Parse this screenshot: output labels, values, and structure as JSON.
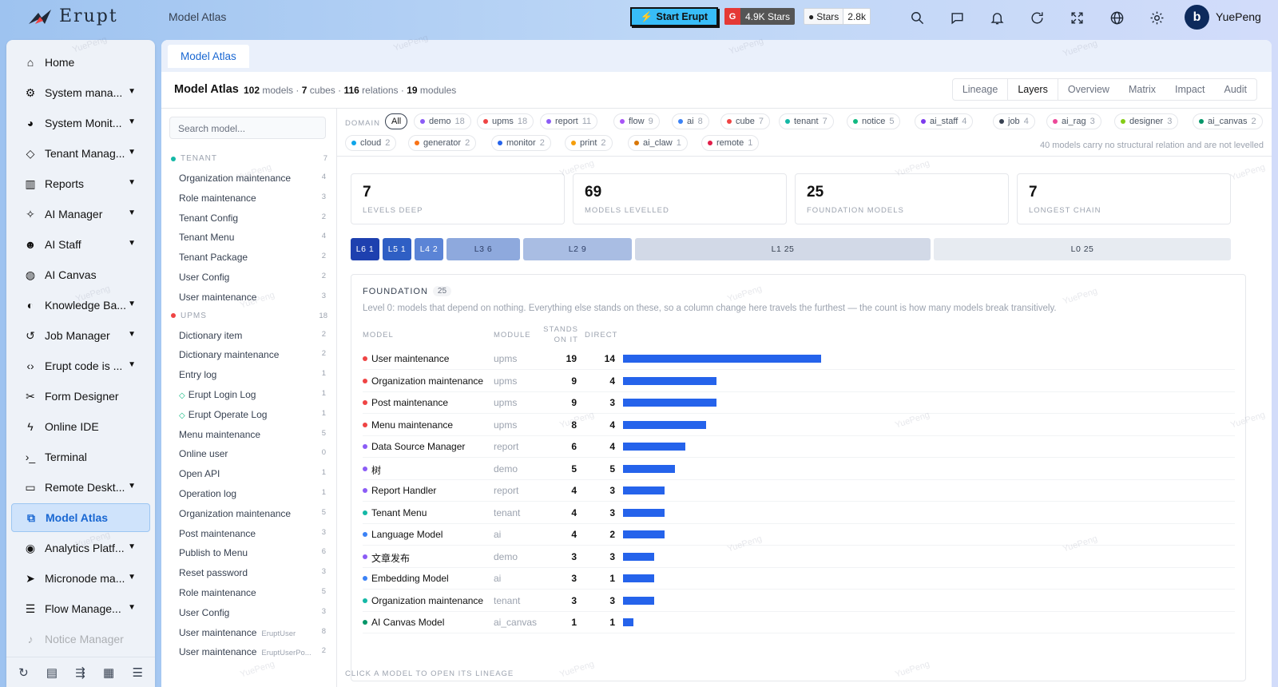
{
  "brand": {
    "name": "Erupt",
    "title": "Model Atlas"
  },
  "header": {
    "start_label": "Start Erupt",
    "gitee_stars": "4.9K Stars",
    "github_label": "Stars",
    "github_count": "2.8k",
    "user": "YuePeng",
    "avatar_initial": "b"
  },
  "sidebar": {
    "items": [
      {
        "label": "Home",
        "icon": "home-icon"
      },
      {
        "label": "System mana...",
        "icon": "gears-icon"
      },
      {
        "label": "System Monit...",
        "icon": "gauge-icon"
      },
      {
        "label": "Tenant Manag...",
        "icon": "gem-icon"
      },
      {
        "label": "Reports",
        "icon": "bar-chart-icon"
      },
      {
        "label": "AI Manager",
        "icon": "magic-icon"
      },
      {
        "label": "AI Staff",
        "icon": "robot-icon"
      },
      {
        "label": "AI Canvas",
        "icon": "palette-icon"
      },
      {
        "label": "Knowledge Ba...",
        "icon": "brain-icon"
      },
      {
        "label": "Job Manager",
        "icon": "history-icon"
      },
      {
        "label": "Erupt code is ...",
        "icon": "code-icon"
      },
      {
        "label": "Form Designer",
        "icon": "tools-icon"
      },
      {
        "label": "Online IDE",
        "icon": "bolt-icon"
      },
      {
        "label": "Terminal",
        "icon": "terminal-icon"
      },
      {
        "label": "Remote Deskt...",
        "icon": "desktop-icon"
      },
      {
        "label": "Model Atlas",
        "icon": "sitemap-icon"
      },
      {
        "label": "Analytics Platf...",
        "icon": "compass-icon"
      },
      {
        "label": "Micronode ma...",
        "icon": "send-icon"
      },
      {
        "label": "Flow Manage...",
        "icon": "sliders-icon"
      },
      {
        "label": "Notice Manager",
        "icon": "bell-icon"
      }
    ]
  },
  "tab": {
    "label": "Model Atlas"
  },
  "summary": {
    "title": "Model Atlas",
    "models": "102",
    "models_label": "models",
    "cubes": "7",
    "cubes_label": "cubes",
    "relations": "116",
    "relations_label": "relations",
    "modules": "19",
    "modules_label": "modules"
  },
  "view_tabs": [
    "Lineage",
    "Layers",
    "Overview",
    "Matrix",
    "Impact",
    "Audit"
  ],
  "search": {
    "placeholder": "Search model..."
  },
  "groups": [
    {
      "name": "TENANT",
      "count": "7",
      "color": "#14b8a6",
      "items": [
        {
          "label": "Organization maintenance",
          "count": "4"
        },
        {
          "label": "Role maintenance",
          "count": "3"
        },
        {
          "label": "Tenant Config",
          "count": "2"
        },
        {
          "label": "Tenant Menu",
          "count": "4"
        },
        {
          "label": "Tenant Package",
          "count": "2"
        },
        {
          "label": "User Config",
          "count": "2"
        },
        {
          "label": "User maintenance",
          "count": "3"
        }
      ]
    },
    {
      "name": "UPMS",
      "count": "18",
      "color": "#ef4444",
      "items": [
        {
          "label": "Dictionary item",
          "count": "2"
        },
        {
          "label": "Dictionary maintenance",
          "count": "2"
        },
        {
          "label": "Entry log",
          "count": "1"
        },
        {
          "label": "Erupt Login Log",
          "count": "1",
          "diamond": true
        },
        {
          "label": "Erupt Operate Log",
          "count": "1",
          "diamond": true
        },
        {
          "label": "Menu maintenance",
          "count": "5"
        },
        {
          "label": "Online user",
          "count": "0"
        },
        {
          "label": "Open API",
          "count": "1"
        },
        {
          "label": "Operation log",
          "count": "1"
        },
        {
          "label": "Organization maintenance",
          "count": "5"
        },
        {
          "label": "Post maintenance",
          "count": "3"
        },
        {
          "label": "Publish to Menu",
          "count": "6"
        },
        {
          "label": "Reset password",
          "count": "3"
        },
        {
          "label": "Role maintenance",
          "count": "5"
        },
        {
          "label": "User Config",
          "count": "3"
        },
        {
          "label": "User maintenance",
          "count": "8",
          "sub": "EruptUser"
        },
        {
          "label": "User maintenance",
          "count": "2",
          "sub": "EruptUserPo..."
        }
      ]
    }
  ],
  "domain": {
    "label": "DOMAIN",
    "all": "All",
    "chips": [
      {
        "name": "demo",
        "count": "18",
        "color": "#8b5cf6"
      },
      {
        "name": "upms",
        "count": "18",
        "color": "#ef4444"
      },
      {
        "name": "report",
        "count": "11",
        "color": "#8b5cf6"
      },
      {
        "name": "flow",
        "count": "9",
        "color": "#a855f7"
      },
      {
        "name": "ai",
        "count": "8",
        "color": "#3b82f6"
      },
      {
        "name": "cube",
        "count": "7",
        "color": "#ef4444"
      },
      {
        "name": "tenant",
        "count": "7",
        "color": "#14b8a6"
      },
      {
        "name": "notice",
        "count": "5",
        "color": "#10b981"
      },
      {
        "name": "ai_staff",
        "count": "4",
        "color": "#7c3aed"
      },
      {
        "name": "job",
        "count": "4",
        "color": "#374151"
      },
      {
        "name": "ai_rag",
        "count": "3",
        "color": "#ec4899"
      },
      {
        "name": "designer",
        "count": "3",
        "color": "#84cc16"
      },
      {
        "name": "ai_canvas",
        "count": "2",
        "color": "#059669"
      },
      {
        "name": "cloud",
        "count": "2",
        "color": "#0ea5e9"
      },
      {
        "name": "generator",
        "count": "2",
        "color": "#f97316"
      },
      {
        "name": "monitor",
        "count": "2",
        "color": "#2563eb"
      },
      {
        "name": "print",
        "count": "2",
        "color": "#f59e0b"
      },
      {
        "name": "ai_claw",
        "count": "1",
        "color": "#d97706"
      },
      {
        "name": "remote",
        "count": "1",
        "color": "#e11d48"
      }
    ],
    "note": "40 models carry no structural relation and are not levelled"
  },
  "stats": [
    {
      "value": "7",
      "label": "LEVELS DEEP"
    },
    {
      "value": "69",
      "label": "MODELS LEVELLED"
    },
    {
      "value": "25",
      "label": "FOUNDATION MODELS"
    },
    {
      "value": "7",
      "label": "LONGEST CHAIN"
    }
  ],
  "levels": [
    {
      "label": "L6  1",
      "bg": "#1e40af",
      "fg": "#ffffff"
    },
    {
      "label": "L5  1",
      "bg": "#2f5fc4",
      "fg": "#ffffff"
    },
    {
      "label": "L4  2",
      "bg": "#5b84d6",
      "fg": "#ffffff"
    },
    {
      "label": "L3  6",
      "bg": "#8ea9dd",
      "fg": "#2d3e66"
    },
    {
      "label": "L2  9",
      "bg": "#a9bde3",
      "fg": "#2d3e66"
    },
    {
      "label": "L1  25",
      "bg": "#d2d9e7",
      "fg": "#374151"
    },
    {
      "label": "L0  25",
      "bg": "#e7ebf1",
      "fg": "#374151"
    }
  ],
  "foundation": {
    "title": "FOUNDATION",
    "count": "25",
    "desc": "Level 0: models that depend on nothing. Everything else stands on these, so a column change here travels the furthest — the count is how many models break transitively.",
    "headers": {
      "model": "MODEL",
      "module": "MODULE",
      "stands1": "STANDS",
      "stands2": "ON IT",
      "direct": "DIRECT"
    },
    "rows": [
      {
        "name": "User maintenance",
        "module": "upms",
        "stands": 19,
        "direct": "14",
        "color": "#ef4444"
      },
      {
        "name": "Organization maintenance",
        "module": "upms",
        "stands": 9,
        "direct": "4",
        "color": "#ef4444"
      },
      {
        "name": "Post maintenance",
        "module": "upms",
        "stands": 9,
        "direct": "3",
        "color": "#ef4444"
      },
      {
        "name": "Menu maintenance",
        "module": "upms",
        "stands": 8,
        "direct": "4",
        "color": "#ef4444"
      },
      {
        "name": "Data Source Manager",
        "module": "report",
        "stands": 6,
        "direct": "4",
        "color": "#8b5cf6"
      },
      {
        "name": "树",
        "module": "demo",
        "stands": 5,
        "direct": "5",
        "color": "#8b5cf6"
      },
      {
        "name": "Report Handler",
        "module": "report",
        "stands": 4,
        "direct": "3",
        "color": "#8b5cf6"
      },
      {
        "name": "Tenant Menu",
        "module": "tenant",
        "stands": 4,
        "direct": "3",
        "color": "#14b8a6"
      },
      {
        "name": "Language Model",
        "module": "ai",
        "stands": 4,
        "direct": "2",
        "color": "#3b82f6"
      },
      {
        "name": "文章发布",
        "module": "demo",
        "stands": 3,
        "direct": "3",
        "color": "#8b5cf6"
      },
      {
        "name": "Embedding Model",
        "module": "ai",
        "stands": 3,
        "direct": "1",
        "color": "#3b82f6"
      },
      {
        "name": "Organization maintenance",
        "module": "tenant",
        "stands": 3,
        "direct": "3",
        "color": "#14b8a6"
      },
      {
        "name": "AI Canvas Model",
        "module": "ai_canvas",
        "stands": 1,
        "direct": "1",
        "color": "#059669"
      }
    ]
  },
  "footer_note": "CLICK A MODEL TO OPEN ITS LINEAGE",
  "watermark": "YuePeng"
}
